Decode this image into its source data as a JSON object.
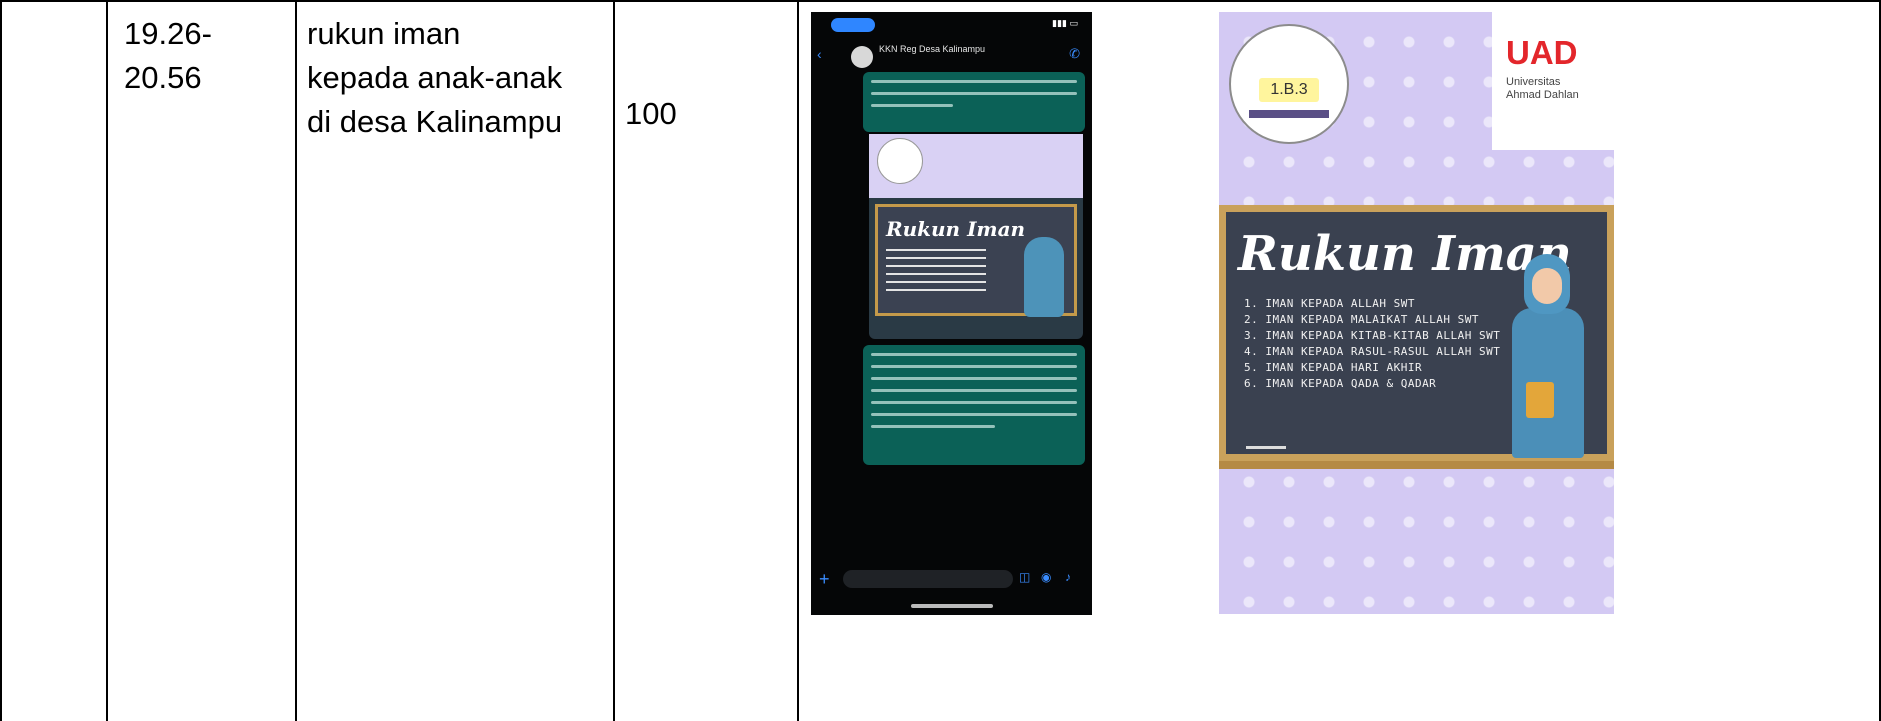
{
  "row": {
    "time": "19.26-\n20.56",
    "activity": "rukun iman\nkepada anak-anak\ndi desa Kalinampu",
    "percent": "100"
  },
  "colors": {
    "grid": "#000000",
    "whatsapp_bubble": "#0b6157",
    "poster_bg": "#d3c9f3",
    "uad_red": "#e3262b",
    "board": "#3a4150",
    "board_frame": "#c9a15b"
  },
  "phone": {
    "group_name": "KKN Reg Desa Kalinampu",
    "icons": [
      "back-icon",
      "call-icon",
      "plus-icon",
      "sticker-icon",
      "camera-icon",
      "mic-icon"
    ]
  },
  "poster": {
    "badge_code": "1.B.3",
    "logo_title": "UAD",
    "logo_subtitle": "Universitas\nAhmad Dahlan",
    "board_title": "Rukun Iman",
    "pillars": [
      "1. IMAN KEPADA ALLAH SWT",
      "2. IMAN KEPADA MALAIKAT ALLAH SWT",
      "3. IMAN KEPADA KITAB-KITAB ALLAH SWT",
      "4. IMAN KEPADA RASUL-RASUL ALLAH SWT",
      "5. IMAN KEPADA HARI AKHIR",
      "6. IMAN KEPADA QADA & QADAR"
    ]
  }
}
